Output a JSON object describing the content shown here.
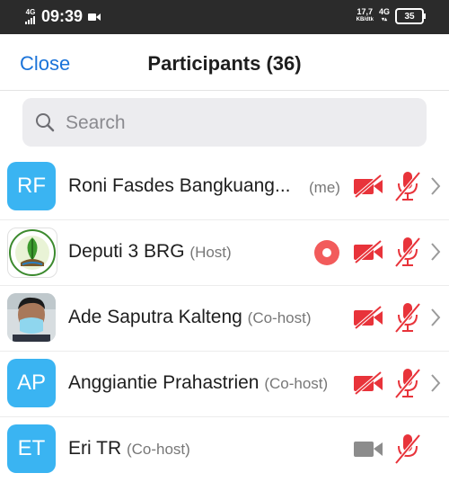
{
  "status_bar": {
    "network_left": "4G",
    "time": "09:39",
    "speed": "17,7",
    "speed_unit": "KB/dtk",
    "network_right": "4G",
    "battery": "35"
  },
  "header": {
    "close_label": "Close",
    "title": "Participants (36)"
  },
  "search": {
    "placeholder": "Search"
  },
  "colors": {
    "accent": "#1a73d9",
    "muted_red": "#e8333a",
    "avatar_blue": "#3ab4f2"
  },
  "participants": [
    {
      "initials": "RF",
      "name": "Roni Fasdes Bangkuang...",
      "role": "",
      "suffix": "(me)",
      "avatar": "initials",
      "recording": false,
      "video": "muted",
      "audio": "muted"
    },
    {
      "initials": "",
      "name": "Deputi 3 BRG",
      "role": "(Host)",
      "suffix": "",
      "avatar": "logo",
      "recording": true,
      "video": "muted",
      "audio": "muted"
    },
    {
      "initials": "",
      "name": "Ade Saputra Kalteng",
      "role": "(Co-host)",
      "suffix": "",
      "avatar": "photo",
      "recording": false,
      "video": "muted",
      "audio": "muted"
    },
    {
      "initials": "AP",
      "name": "Anggiantie Prahastrien",
      "role": "(Co-host)",
      "suffix": "",
      "avatar": "initials",
      "recording": false,
      "video": "muted",
      "audio": "muted"
    },
    {
      "initials": "ET",
      "name": "Eri TR",
      "role": "(Co-host)",
      "suffix": "",
      "avatar": "initials",
      "recording": false,
      "video": "off-gray",
      "audio": "muted"
    }
  ]
}
